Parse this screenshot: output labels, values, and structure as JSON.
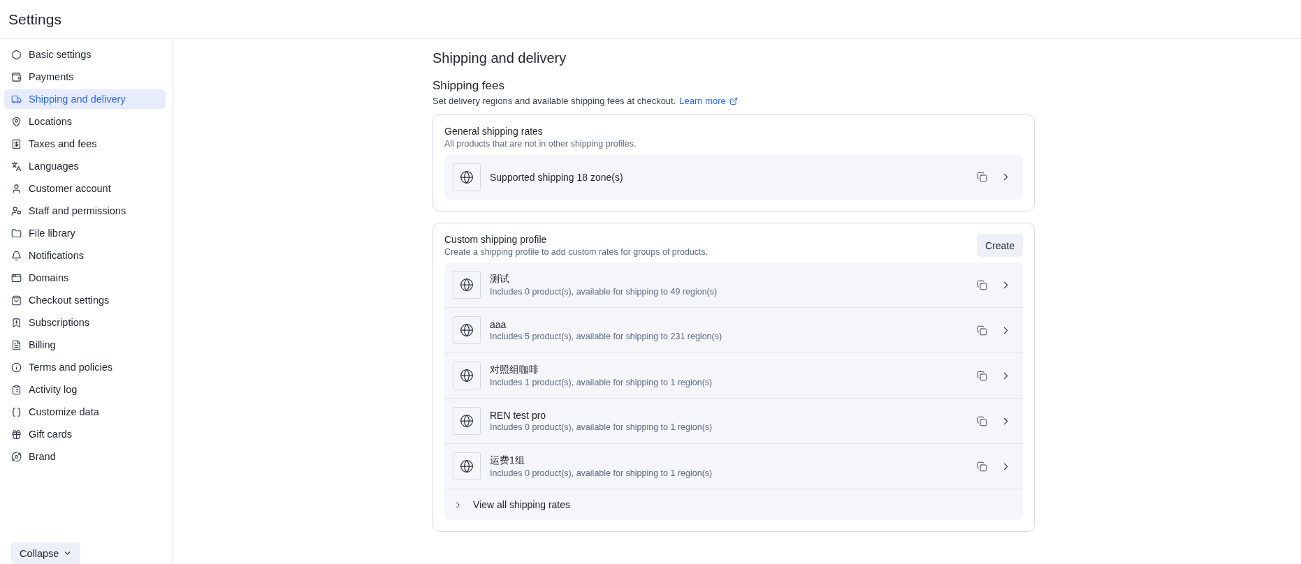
{
  "window": {
    "title": "Settings"
  },
  "sidebar": {
    "items": [
      {
        "label": "Basic settings",
        "selected": false
      },
      {
        "label": "Payments",
        "selected": false
      },
      {
        "label": "Shipping and delivery",
        "selected": true
      },
      {
        "label": "Locations",
        "selected": false
      },
      {
        "label": "Taxes and fees",
        "selected": false
      },
      {
        "label": "Languages",
        "selected": false
      },
      {
        "label": "Customer account",
        "selected": false
      },
      {
        "label": "Staff and permissions",
        "selected": false
      },
      {
        "label": "File library",
        "selected": false
      },
      {
        "label": "Notifications",
        "selected": false
      },
      {
        "label": "Domains",
        "selected": false
      },
      {
        "label": "Checkout settings",
        "selected": false
      },
      {
        "label": "Subscriptions",
        "selected": false
      },
      {
        "label": "Billing",
        "selected": false
      },
      {
        "label": "Terms and policies",
        "selected": false
      },
      {
        "label": "Activity log",
        "selected": false
      },
      {
        "label": "Customize data",
        "selected": false
      },
      {
        "label": "Gift cards",
        "selected": false
      },
      {
        "label": "Brand",
        "selected": false
      }
    ],
    "collapse_button": "Collapse"
  },
  "page": {
    "title": "Shipping and delivery",
    "section": {
      "title": "Shipping fees",
      "description": "Set delivery regions and available shipping fees at checkout.",
      "link": "Learn more"
    }
  },
  "general_rates": {
    "title": "General shipping rates",
    "subtitle": "All products that are not in other shipping profiles.",
    "rows": [
      {
        "name": "Supported shipping 18 zone(s)"
      }
    ]
  },
  "custom_profiles": {
    "title": "Custom shipping profile",
    "subtitle": "Create a shipping profile to add custom rates for groups of products.",
    "create_button": "Create",
    "rows": [
      {
        "name": "测试",
        "detail": "Includes 0 product(s), available for shipping to 49 region(s)"
      },
      {
        "name": "aaa",
        "detail": "Includes 5 product(s), available for shipping to 231 region(s)"
      },
      {
        "name": "对照组咖啡",
        "detail": "Includes 1 product(s), available for shipping to 1 region(s)"
      },
      {
        "name": "REN test pro",
        "detail": "Includes 0 product(s), available for shipping to 1 region(s)"
      },
      {
        "name": "运费1组",
        "detail": "Includes 0 product(s), available for shipping to 1 region(s)"
      }
    ],
    "view_all": "View all shipping rates"
  }
}
